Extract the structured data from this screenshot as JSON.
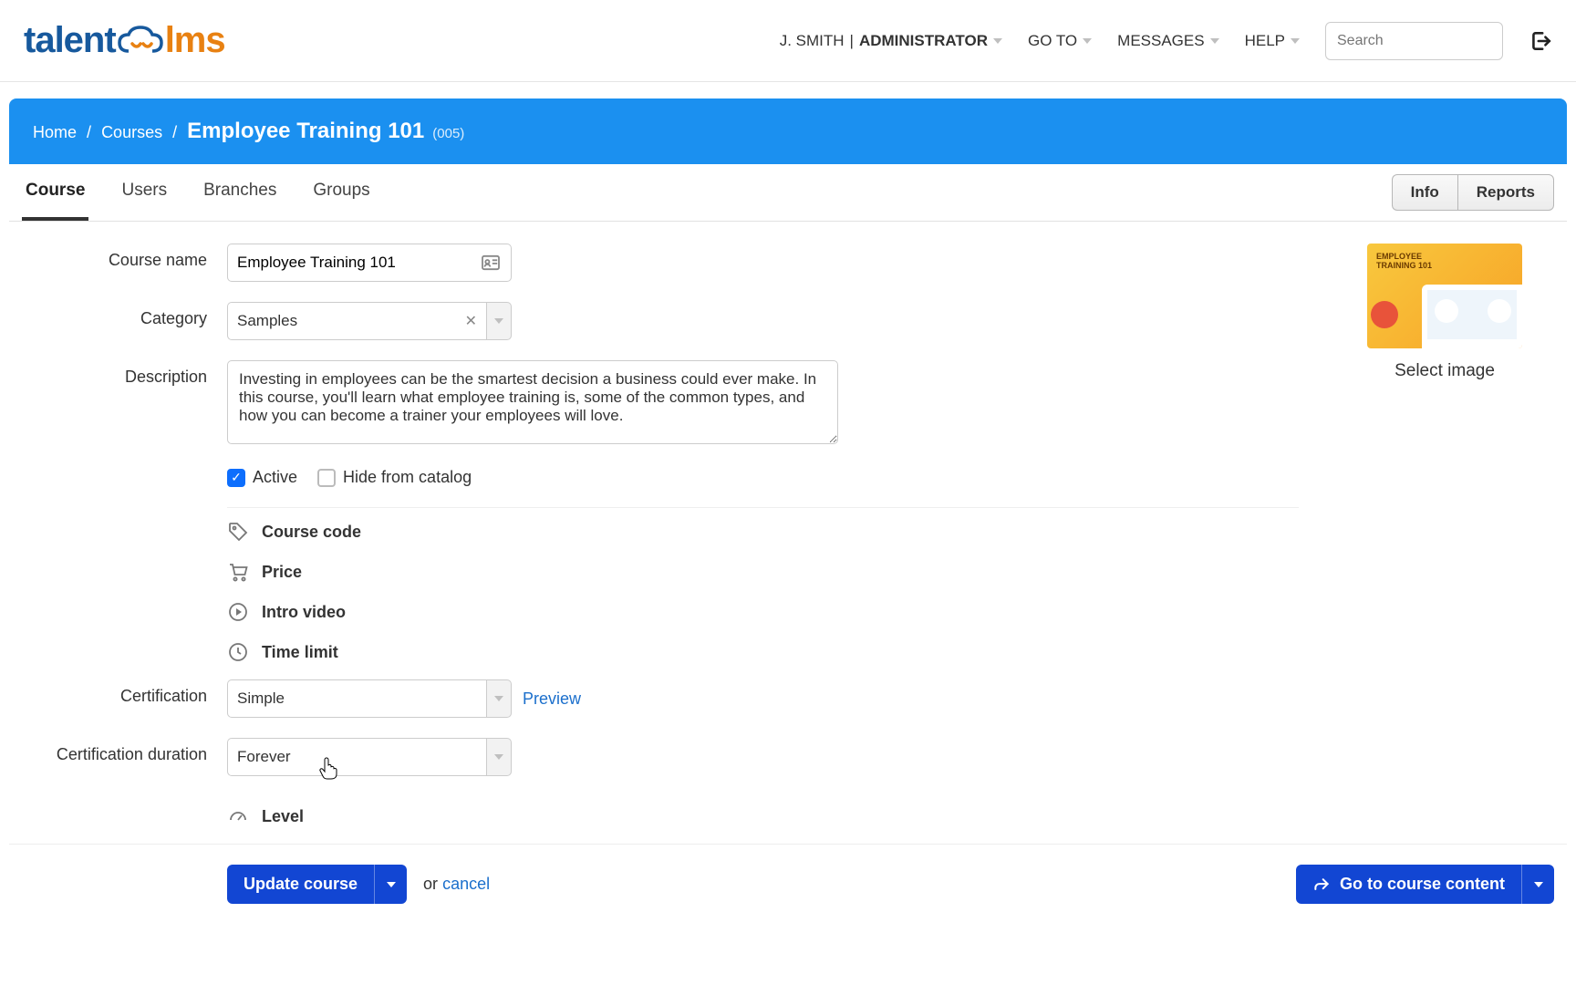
{
  "header": {
    "user": "J. SMITH",
    "role": "ADMINISTRATOR",
    "nav": {
      "goto": "GO TO",
      "messages": "MESSAGES",
      "help": "HELP"
    },
    "search_placeholder": "Search"
  },
  "breadcrumb": {
    "home": "Home",
    "courses": "Courses",
    "title": "Employee Training 101",
    "code": "(005)"
  },
  "tabs": {
    "course": "Course",
    "users": "Users",
    "branches": "Branches",
    "groups": "Groups"
  },
  "rightbtns": {
    "info": "Info",
    "reports": "Reports"
  },
  "form": {
    "labels": {
      "course_name": "Course name",
      "category": "Category",
      "description": "Description",
      "certification": "Certification",
      "cert_duration": "Certification duration"
    },
    "course_name": "Employee Training 101",
    "category": "Samples",
    "description": "Investing in employees can be the smartest decision a business could ever make. In this course, you'll learn what employee training is, some of the common types, and how you can become a trainer your employees will love.",
    "active_label": "Active",
    "hide_label": "Hide from catalog",
    "active_checked": true,
    "hide_checked": false,
    "certification": "Simple",
    "cert_duration": "Forever",
    "preview": "Preview"
  },
  "extras": {
    "course_code": "Course code",
    "price": "Price",
    "intro_video": "Intro video",
    "time_limit": "Time limit",
    "level": "Level"
  },
  "image": {
    "thumb_title": "EMPLOYEE\nTRAINING 101",
    "select": "Select image"
  },
  "footer": {
    "update": "Update course",
    "or": "or ",
    "cancel": "cancel",
    "goto_content": "Go to course content"
  }
}
